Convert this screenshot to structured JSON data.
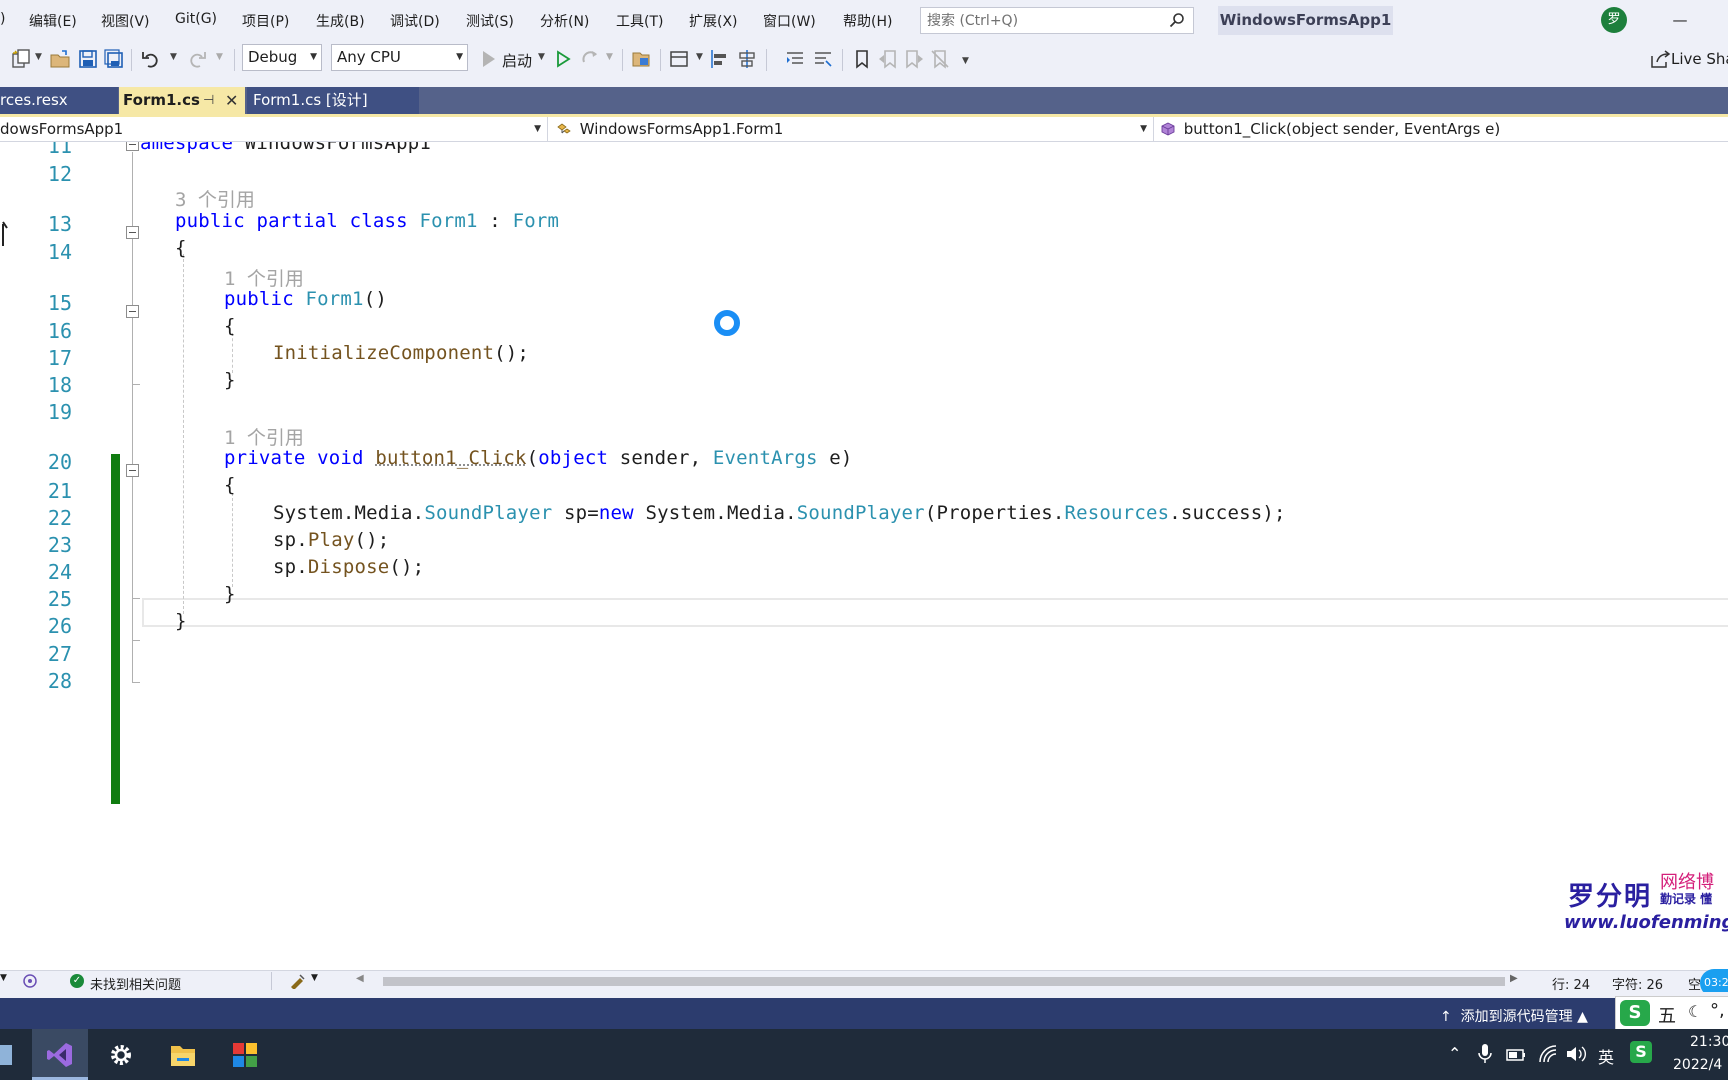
{
  "menu": {
    "items": [
      "编辑(E)",
      "视图(V)",
      "Git(G)",
      "项目(P)",
      "生成(B)",
      "调试(D)",
      "测试(S)",
      "分析(N)",
      "工具(T)",
      "扩展(X)",
      "窗口(W)",
      "帮助(H)"
    ],
    "leading_fragment": ")"
  },
  "search": {
    "placeholder": "搜索 (Ctrl+Q)"
  },
  "solution_name": "WindowsFormsApp1",
  "user_avatar_initial": "罗",
  "toolbar": {
    "configuration": "Debug",
    "platform": "Any CPU",
    "start_label": "启动",
    "live_share_label": "Live Sha"
  },
  "tabs": [
    {
      "label": "rces.resx",
      "active": false
    },
    {
      "label": "Form1.cs",
      "active": true
    },
    {
      "label": "Form1.cs [设计]",
      "active": false
    }
  ],
  "navbar": {
    "project": "dowsFormsApp1",
    "type": "WindowsFormsApp1.Form1",
    "member": "button1_Click(object sender, EventArgs e)"
  },
  "editor": {
    "line_numbers": [
      "11",
      "12",
      "13",
      "14",
      "15",
      "16",
      "17",
      "18",
      "19",
      "20",
      "21",
      "22",
      "23",
      "24",
      "25",
      "26",
      "27",
      "28"
    ],
    "lens": [
      "3 个引用",
      "1 个引用",
      "1 个引用"
    ],
    "code": {
      "l11_kw": "amespace",
      "l11_name": " WindowsFormsApp1",
      "l13_kw1": "public",
      "l13_kw2": " partial",
      "l13_kw3": " class",
      "l13_type": " Form1",
      "l13_colon": " : ",
      "l13_base": "Form",
      "open_brace": "{",
      "close_brace": "}",
      "l15_kw": "public",
      "l15_type": " Form1",
      "l15_parens": "()",
      "l17_fn": "InitializeComponent",
      "l17_rest": "();",
      "l20_kw1": "private",
      "l20_kw2": " void",
      "l20_sp": " ",
      "l20_fn": "button1_Click",
      "l20_paren": "(",
      "l20_kw3": "object",
      "l20_arg1": " sender, ",
      "l20_type": "EventArgs",
      "l20_arg2": " e)",
      "l22_ns1": "System.Media.",
      "l22_type1": "SoundPlayer",
      "l22_mid": " sp=",
      "l22_new": "new",
      "l22_ns2": " System.Media.",
      "l22_type2": "SoundPlayer",
      "l22_props": "(Properties.",
      "l22_res": "Resources",
      "l22_end": ".success);",
      "l23_var": "sp.",
      "l23_fn": "Play",
      "l23_end": "();",
      "l24_var": "sp.",
      "l24_fn": "Dispose",
      "l24_end": "();"
    }
  },
  "watermark": {
    "name": "罗分明",
    "blog": "网络博",
    "motto": "勤记录 懂",
    "url": "www.luofenming.c"
  },
  "editor_status": {
    "issues": "未找到相关问题",
    "line": "行: 24",
    "char": "字符: 26",
    "space": "空",
    "clock_badge": "03:2"
  },
  "status_bar": {
    "source_control": "添加到源代码管理",
    "ime_mode": "五",
    "ime_logo": "S"
  },
  "taskbar": {
    "time": "21:30",
    "date": "2022/4",
    "lang": "英"
  },
  "colors": {
    "keyword": "#0000ff",
    "type": "#2b91af",
    "method": "#74531f",
    "change_bar": "#107c10",
    "active_tab": "#f6e8a6",
    "status_bar": "#2c3c6e"
  }
}
